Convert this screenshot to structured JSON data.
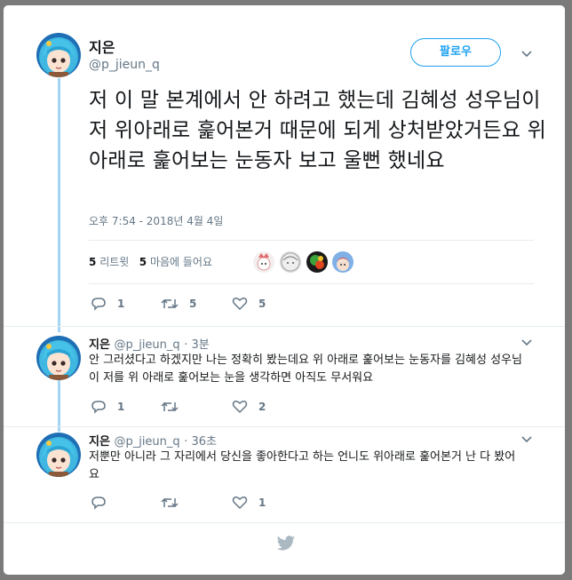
{
  "main_tweet": {
    "name": "지은",
    "handle": "@p_jieun_q",
    "follow_label": "팔로우",
    "text": "저 이 말 본계에서 안 하려고 했는데 김혜성 성우님이 저 위아래로 훑어본거 때문에 되게 상처받았거든요 위아래로 훑어보는 눈동자 보고 울뻔 했네요",
    "timestamp": "오후 7:54 - 2018년 4월 4일",
    "retweets_count": "5",
    "retweets_label": "리트윗",
    "likes_count": "5",
    "likes_label": "마음에 들어요",
    "actions": {
      "reply": "1",
      "retweet": "5",
      "like": "5"
    }
  },
  "replies": [
    {
      "name": "지은",
      "handle": "@p_jieun_q",
      "time": "· 3분",
      "text": "안 그러셨다고 하겠지만 나는 정확히 봤는데요 위 아래로 훑어보는 눈동자를 김혜성 성우님이 저를 위 아래로 훑어보는 눈을 생각하면 아직도 무서워요",
      "actions": {
        "reply": "1",
        "retweet": "",
        "like": "2"
      }
    },
    {
      "name": "지은",
      "handle": "@p_jieun_q",
      "time": "· 36초",
      "text": "저뿐만 아니라 그 자리에서 당신을 좋아한다고 하는 언니도 위아래로 훑어본거 난 다 봤어요",
      "actions": {
        "reply": "",
        "retweet": "",
        "like": "1"
      }
    }
  ],
  "colors": {
    "accent": "#1da1f2",
    "thread_line": "#a3d6f2",
    "muted": "#657786",
    "bird": "#aab8c2"
  }
}
